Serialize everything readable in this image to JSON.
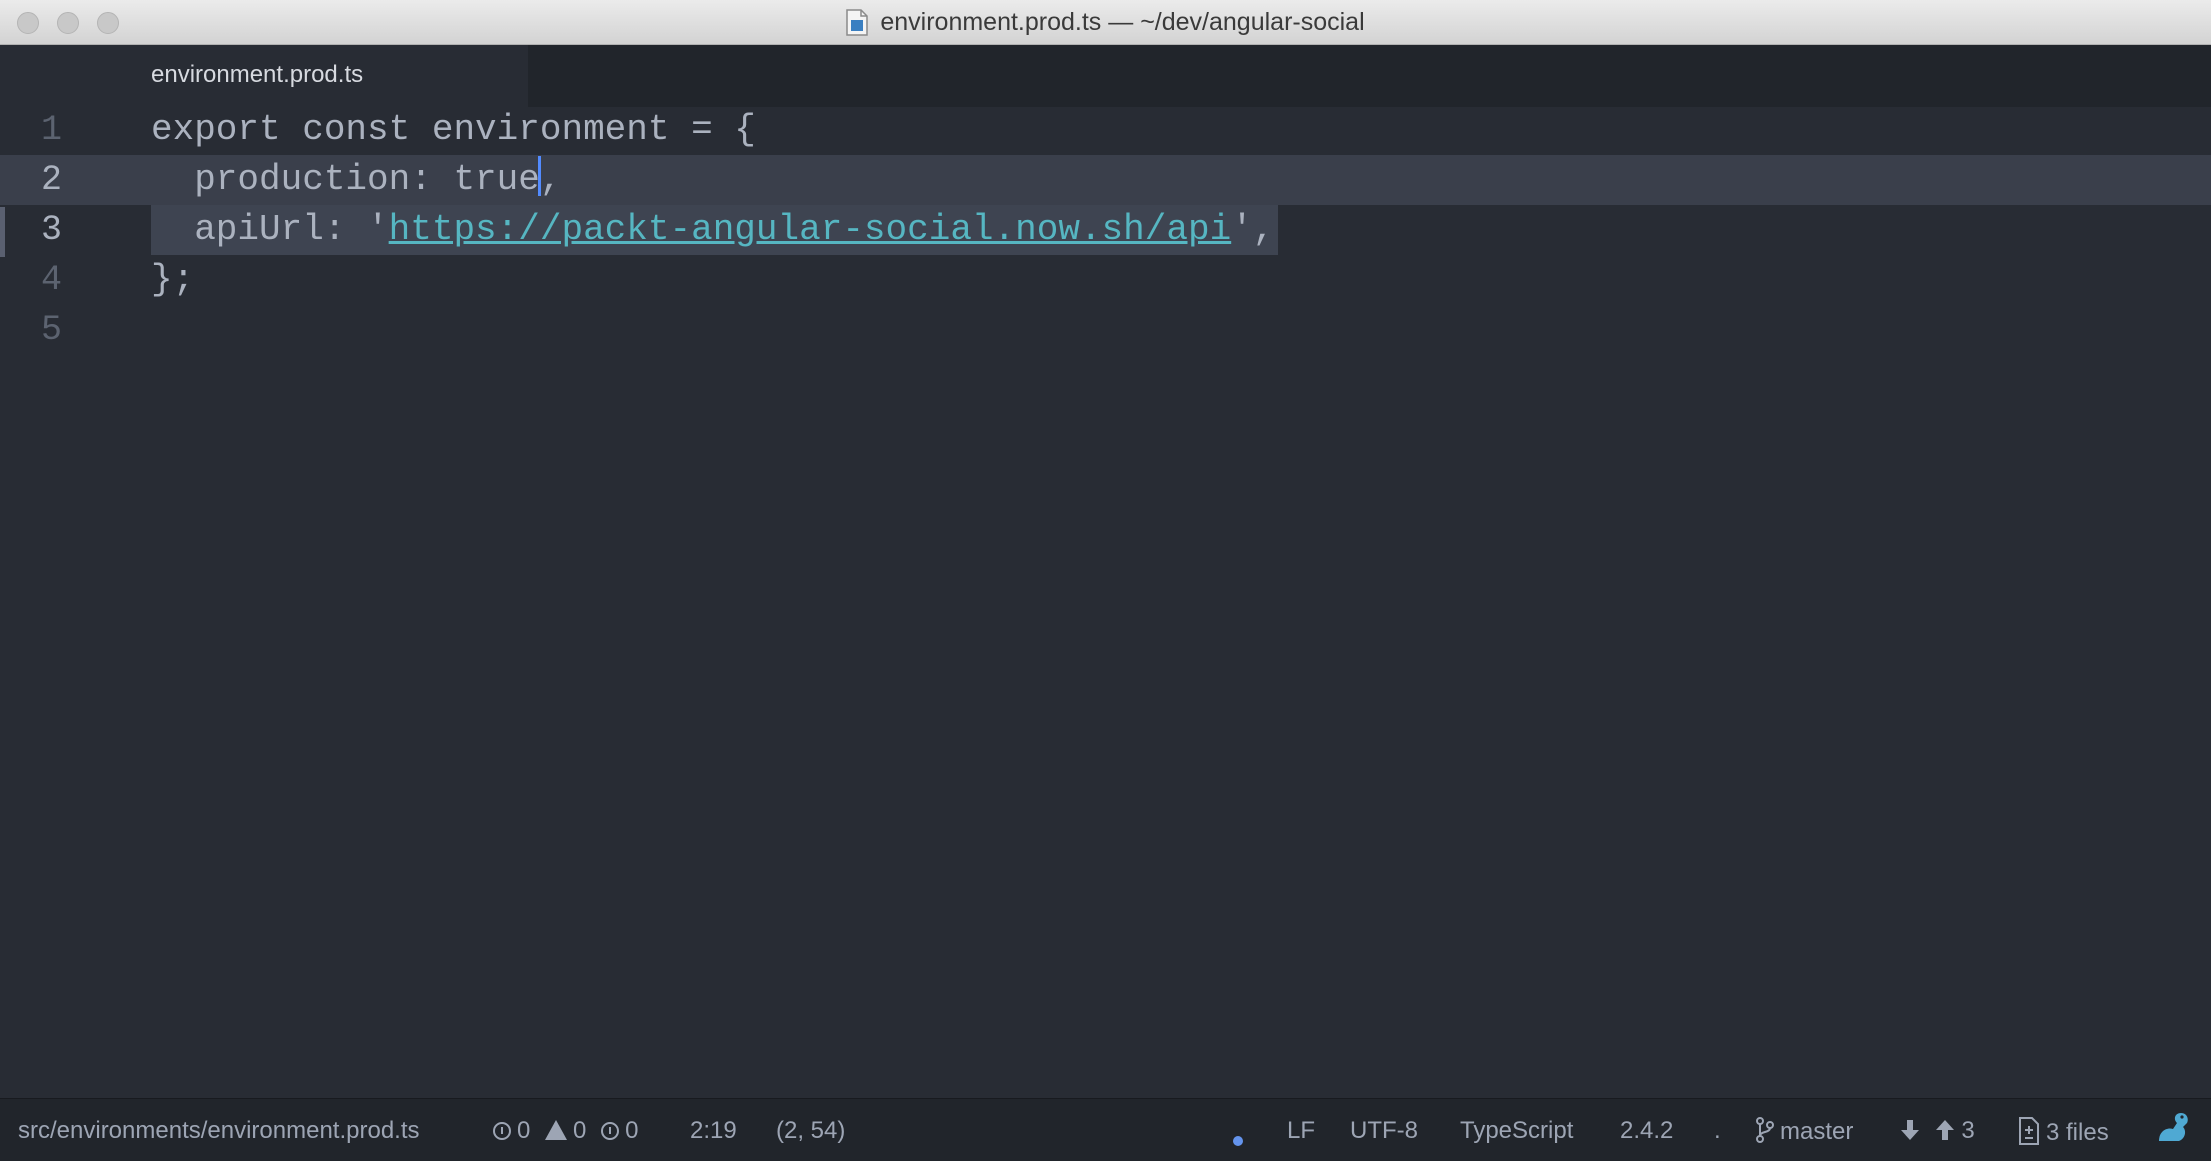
{
  "window": {
    "title": "environment.prod.ts — ~/dev/angular-social"
  },
  "tabs": [
    {
      "label": "environment.prod.ts",
      "active": true
    }
  ],
  "editor": {
    "line_numbers": [
      "1",
      "2",
      "3",
      "4",
      "5"
    ],
    "lines": [
      {
        "text": "export const environment = {"
      },
      {
        "before_caret": "  production: true",
        "after_caret": ","
      },
      {
        "prefix": "  apiUrl: '",
        "url": "https://packt-angular-social.now.sh/api",
        "suffix": "',"
      },
      {
        "text": "};"
      },
      {
        "text": ""
      }
    ]
  },
  "statusbar": {
    "file_path": "src/environments/environment.prod.ts",
    "errors": "0",
    "warnings": "0",
    "infos": "0",
    "cursor_position": "2:19",
    "selection": "(2, 54)",
    "line_ending": "LF",
    "encoding": "UTF-8",
    "grammar": "TypeScript",
    "ts_version": "2.4.2",
    "separator": ".",
    "branch": "master",
    "push_count": "3",
    "files_changed": "3 files"
  },
  "colors": {
    "editor_bg": "#282c34",
    "url": "#56b6c2",
    "caret": "#528bff",
    "squirrel": "#4fa9d3"
  }
}
